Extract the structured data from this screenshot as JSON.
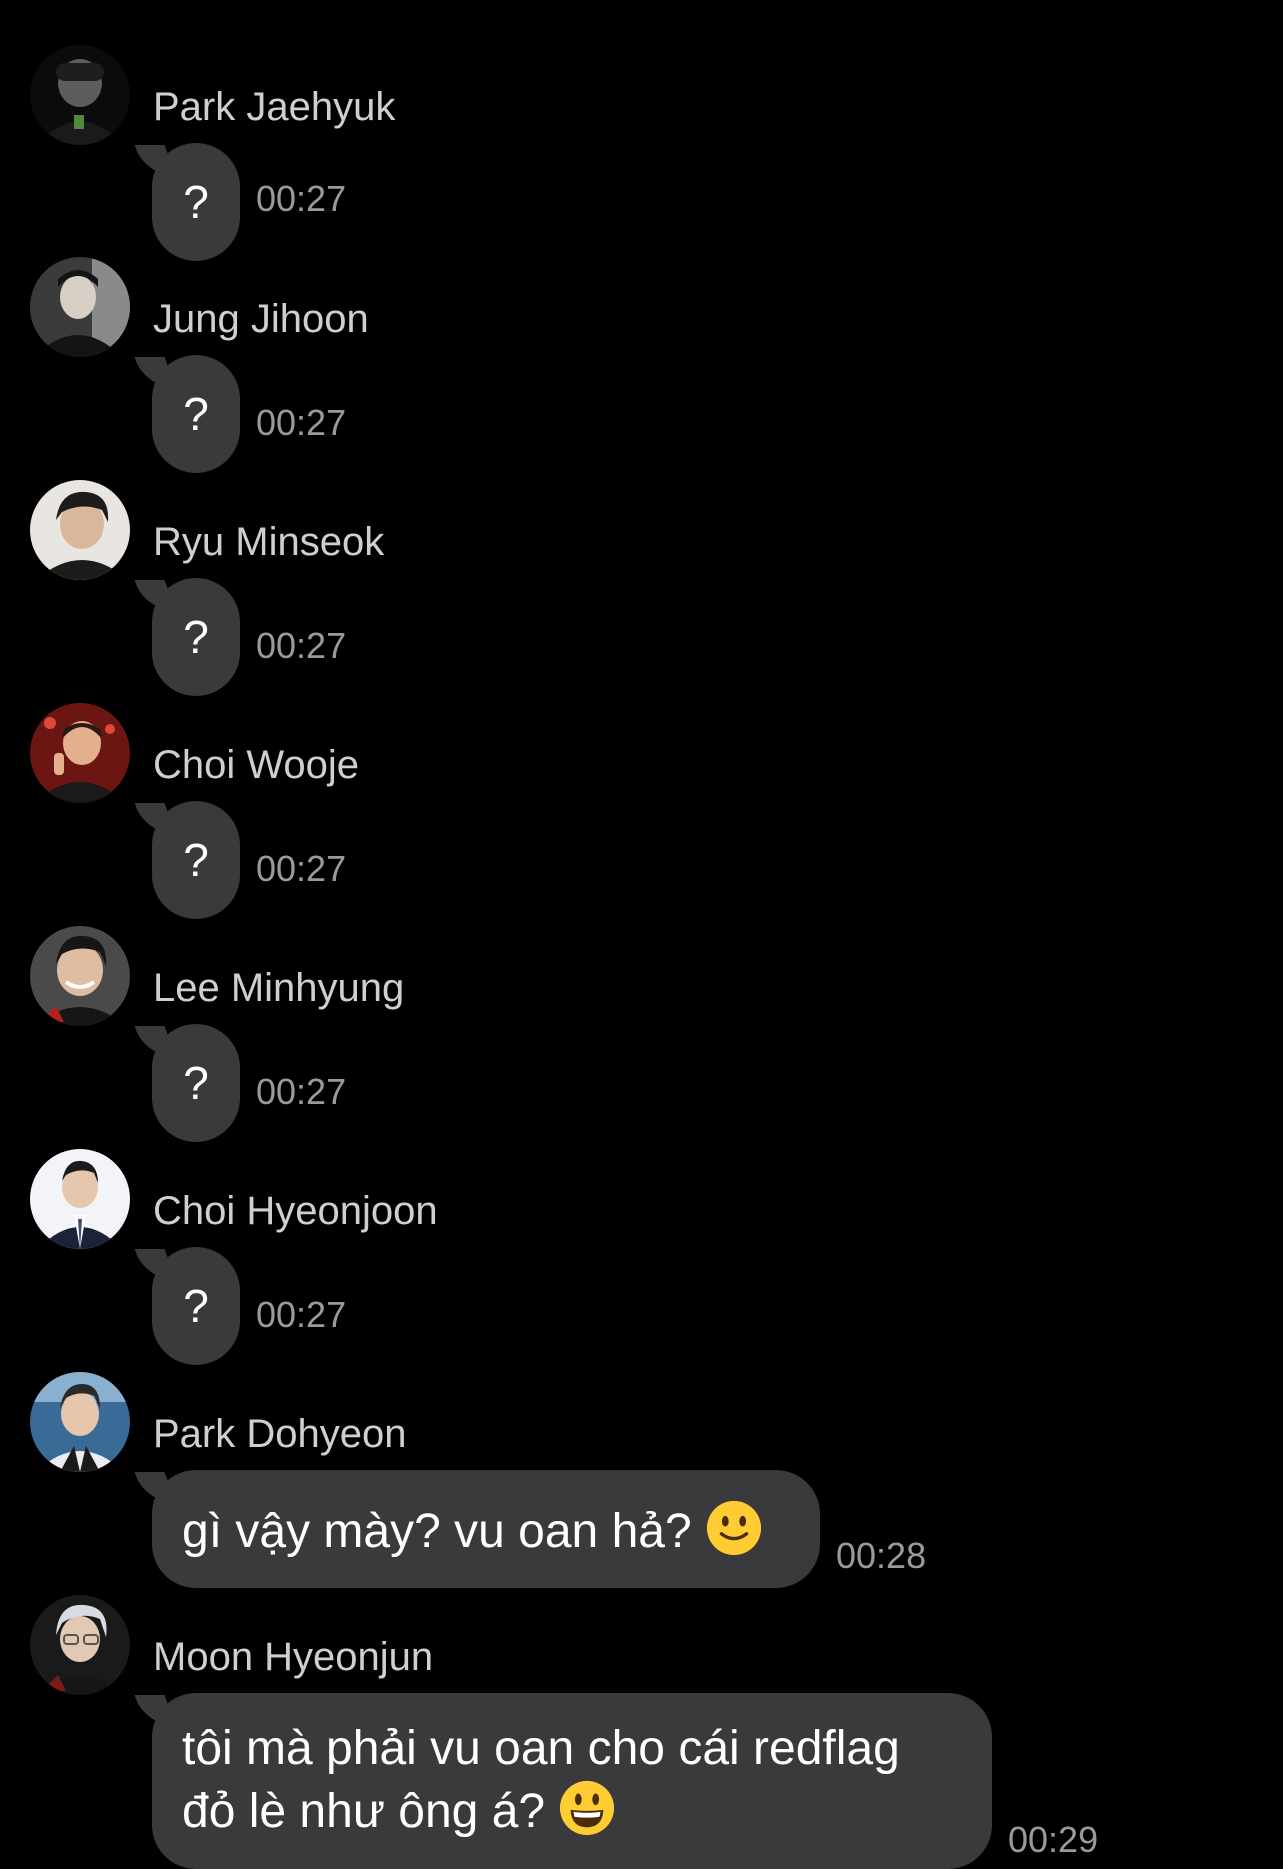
{
  "messages": [
    {
      "sender": "Park Jaehyuk",
      "avatar_icon": "avatar-photo-icon",
      "avatar_colors": [
        "#1a1a1a",
        "#6b6b6b",
        "#2e3b2a"
      ],
      "text": "?",
      "time": "00:27"
    },
    {
      "sender": "Jung Jihoon",
      "avatar_icon": "avatar-photo-icon",
      "avatar_colors": [
        "#2b2b2b",
        "#d8d0c6",
        "#141414"
      ],
      "text": "?",
      "time": "00:27"
    },
    {
      "sender": "Ryu Minseok",
      "avatar_icon": "avatar-photo-icon",
      "avatar_colors": [
        "#e9e6e1",
        "#1c1c1c",
        "#d9b79d"
      ],
      "text": "?",
      "time": "00:27"
    },
    {
      "sender": "Choi Wooje",
      "avatar_icon": "avatar-photo-icon",
      "avatar_colors": [
        "#6b1612",
        "#1a1a1a",
        "#e2b08d"
      ],
      "text": "?",
      "time": "00:27"
    },
    {
      "sender": "Lee Minhyung",
      "avatar_icon": "avatar-photo-icon",
      "avatar_colors": [
        "#4a4a4a",
        "#161616",
        "#e0bca0"
      ],
      "text": "?",
      "time": "00:27"
    },
    {
      "sender": "Choi Hyeonjoon",
      "avatar_icon": "avatar-photo-icon",
      "avatar_colors": [
        "#f2f4f7",
        "#1b2338",
        "#e6c7ad"
      ],
      "text": "?",
      "time": "00:27"
    },
    {
      "sender": "Park Dohyeon",
      "avatar_icon": "avatar-photo-icon",
      "avatar_colors": [
        "#3a6a96",
        "#ececec",
        "#1a1a1a"
      ],
      "text": "gì vậy mày? vu oan hả?",
      "emoji": "slightly-smiling-face-emoji",
      "time": "00:28"
    },
    {
      "sender": "Moon Hyeonjun",
      "avatar_icon": "avatar-photo-icon",
      "avatar_colors": [
        "#d7dce4",
        "#1a1a1a",
        "#7a1b1b"
      ],
      "text": "tôi mà phải vu oan cho cái redflag\nđỏ lè như ông á?",
      "emoji": "grinning-face-emoji",
      "time": "00:29"
    }
  ],
  "colors": {
    "background": "#000000",
    "bubble": "#3a3a3c",
    "sender_text": "#cfcfcf",
    "timestamp_text": "#9a9a9a",
    "emoji_face": "#ffcc33"
  }
}
